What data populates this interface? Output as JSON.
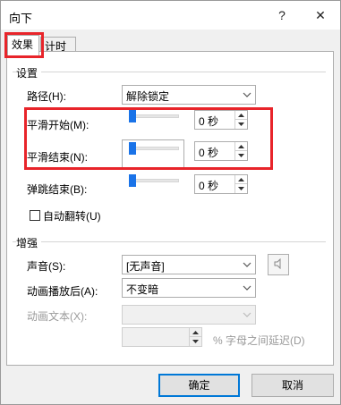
{
  "window": {
    "title": "向下",
    "help": "?",
    "close": "✕"
  },
  "tabs": [
    {
      "label": "效果"
    },
    {
      "label": "计时"
    }
  ],
  "settings": {
    "group_title": "设置",
    "path": {
      "label": "路径(H):",
      "value": "解除锁定"
    },
    "smooth_start": {
      "label": "平滑开始(M):",
      "value": "0 秒",
      "fraction": 0
    },
    "smooth_end": {
      "label": "平滑结束(N):",
      "value": "0 秒",
      "fraction": 0
    },
    "bounce_end": {
      "label": "弹跳结束(B):",
      "value": "0 秒",
      "fraction": 0
    },
    "auto_reverse": {
      "label": "自动翻转(U)",
      "checked": false
    }
  },
  "enhance": {
    "group_title": "增强",
    "sound": {
      "label": "声音(S):",
      "value": "[无声音]"
    },
    "after_anim": {
      "label": "动画播放后(A):",
      "value": "不变暗"
    },
    "anim_text": {
      "label": "动画文本(X):",
      "value": ""
    },
    "delay": {
      "value": "",
      "suffix": "% 字母之间延迟(D)"
    }
  },
  "footer": {
    "ok": "确定",
    "cancel": "取消"
  },
  "colors": {
    "highlight": "#e8242a",
    "accent": "#1a73e8"
  }
}
